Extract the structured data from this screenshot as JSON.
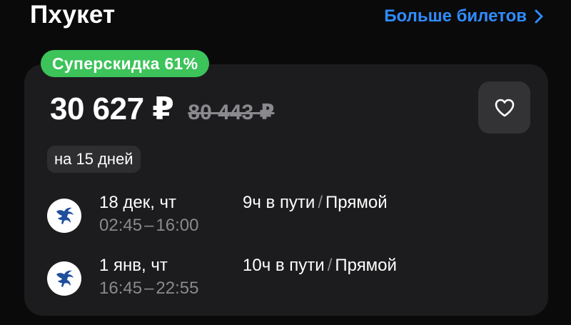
{
  "header": {
    "title": "Пхукет",
    "more_link": "Больше билетов"
  },
  "offer": {
    "badge": "Суперскидка 61%",
    "price": "30 627 ₽",
    "old_price": "80 443 ₽",
    "duration": "на 15 дней"
  },
  "flights": [
    {
      "date": "18 дек, чт",
      "depart": "02:45",
      "dash": "–",
      "arrive": "16:00",
      "travel_time": "9ч в пути",
      "slash": "/",
      "stops": "Прямой"
    },
    {
      "date": "1 янв, чт",
      "depart": "16:45",
      "dash": "–",
      "arrive": "22:55",
      "travel_time": "10ч в пути",
      "slash": "/",
      "stops": "Прямой"
    }
  ],
  "colors": {
    "accent_link": "#2f8cff",
    "badge_green": "#3cc35a",
    "card_bg": "#1c1c1e",
    "muted_text": "#8a8a8e"
  },
  "icons": {
    "more_link_icon": "chevron-right-icon",
    "favorite_icon": "heart-outline-icon",
    "airline_icon": "pegasus-logo-icon"
  }
}
